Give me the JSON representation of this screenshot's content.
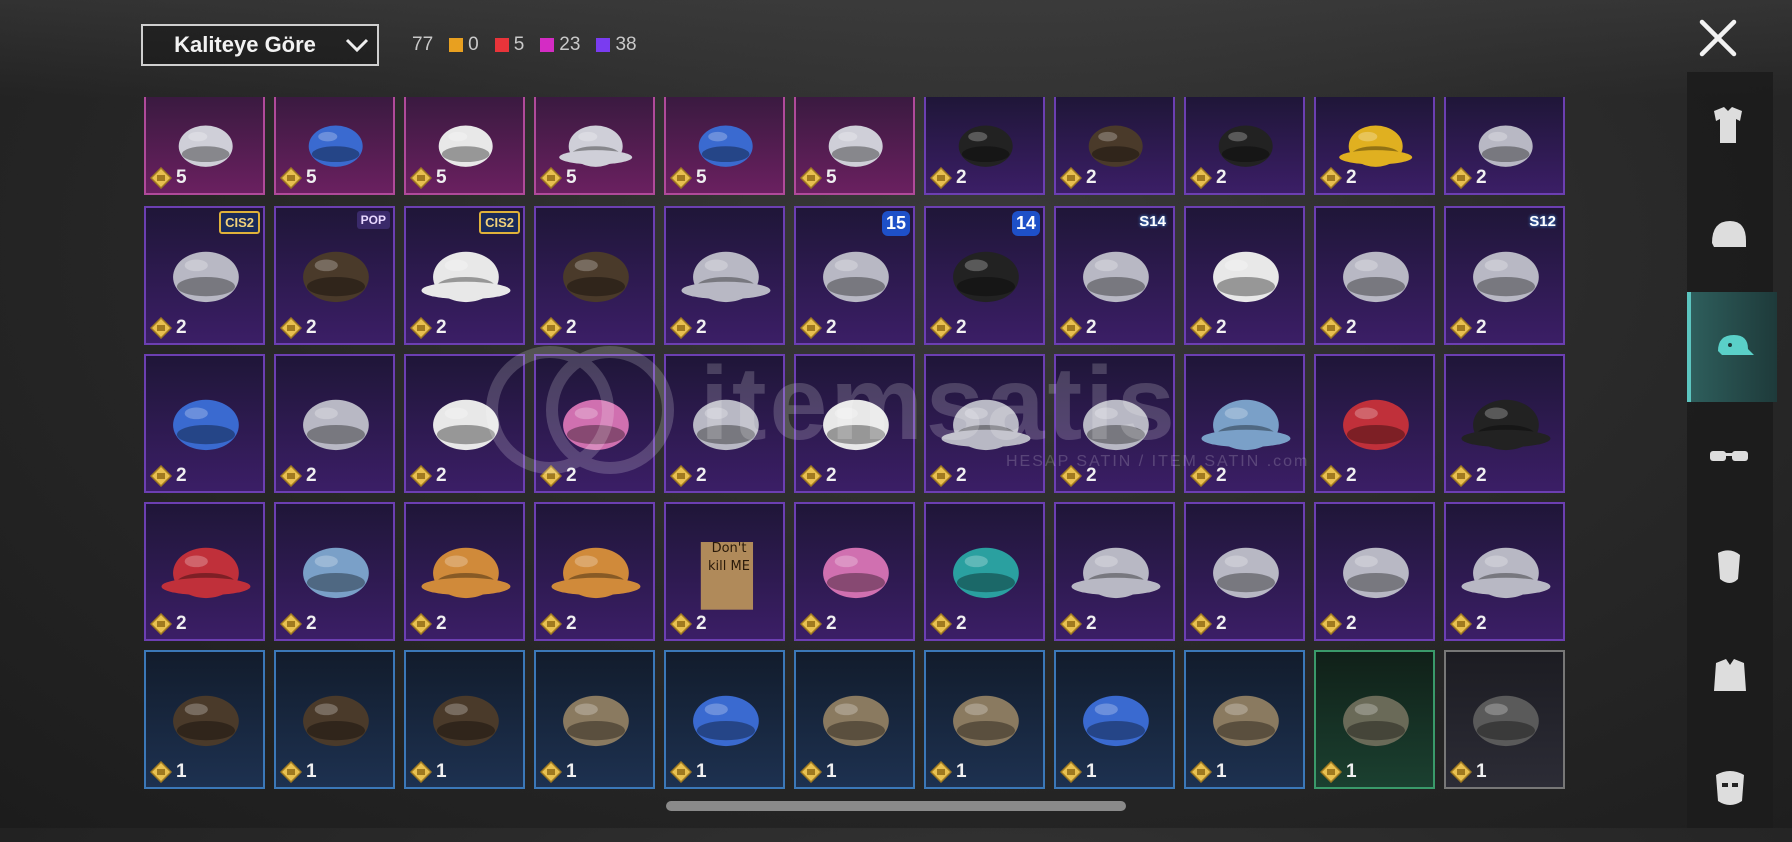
{
  "sort": {
    "label": "Kaliteye Göre"
  },
  "counts": {
    "total": "77",
    "groups": [
      {
        "color": "#e8a020",
        "value": "0"
      },
      {
        "color": "#e8343a",
        "value": "5"
      },
      {
        "color": "#d42cc4",
        "value": "23"
      },
      {
        "color": "#7a3cf0",
        "value": "38"
      }
    ]
  },
  "watermark": {
    "brand": "itemsatis",
    "tagline": "HESAP SATIN / ITEM SATIN .com"
  },
  "rows": [
    {
      "tiles": [
        {
          "tier": "pink",
          "qty": "5",
          "icon": "mask-helmet-icon"
        },
        {
          "tier": "pink",
          "qty": "5",
          "icon": "blue-helmet-icon"
        },
        {
          "tier": "pink",
          "qty": "5",
          "icon": "white-helmet-icon"
        },
        {
          "tier": "pink",
          "qty": "5",
          "icon": "witch-hat-icon"
        },
        {
          "tier": "pink",
          "qty": "5",
          "icon": "goggle-helmet-icon"
        },
        {
          "tier": "pink",
          "qty": "5",
          "icon": "horn-headband-icon"
        },
        {
          "tier": "purple",
          "qty": "2",
          "icon": "dark-hair-icon"
        },
        {
          "tier": "purple",
          "qty": "2",
          "icon": "gray-hair-icon"
        },
        {
          "tier": "purple",
          "qty": "2",
          "icon": "black-cap-icon"
        },
        {
          "tier": "purple",
          "qty": "2",
          "icon": "yellow-hat-icon"
        },
        {
          "tier": "purple",
          "qty": "2",
          "icon": "horned-helmet-icon"
        }
      ]
    },
    {
      "tiles": [
        {
          "tier": "purple",
          "qty": "2",
          "icon": "striped-beanie-icon",
          "badge": "CIS2",
          "badgeType": "cis"
        },
        {
          "tier": "purple",
          "qty": "2",
          "icon": "silver-hair-icon",
          "badge": "POP",
          "badgeType": "pop"
        },
        {
          "tier": "purple",
          "qty": "2",
          "icon": "chef-hat-icon",
          "badge": "CIS2",
          "badgeType": "cis"
        },
        {
          "tier": "purple",
          "qty": "2",
          "icon": "brown-hair-icon"
        },
        {
          "tier": "purple",
          "qty": "2",
          "icon": "fedora-icon"
        },
        {
          "tier": "purple",
          "qty": "2",
          "icon": "knight-helmet-icon",
          "badge": "15",
          "badgeType": "num"
        },
        {
          "tier": "purple",
          "qty": "2",
          "icon": "police-cap-icon",
          "badge": "14",
          "badgeType": "num"
        },
        {
          "tier": "purple",
          "qty": "2",
          "icon": "spartan-helmet-icon",
          "badge": "S14",
          "badgeType": "s"
        },
        {
          "tier": "purple",
          "qty": "2",
          "icon": "white-turban-icon"
        },
        {
          "tier": "purple",
          "qty": "2",
          "icon": "spiked-helmet-icon"
        },
        {
          "tier": "purple",
          "qty": "2",
          "icon": "space-helmet-icon",
          "badge": "S12",
          "badgeType": "s"
        }
      ]
    },
    {
      "tiles": [
        {
          "tier": "purple",
          "qty": "2",
          "icon": "bird-beanie-icon"
        },
        {
          "tier": "purple",
          "qty": "2",
          "icon": "knit-beanie-icon"
        },
        {
          "tier": "purple",
          "qty": "2",
          "icon": "turban-icon"
        },
        {
          "tier": "purple",
          "qty": "2",
          "icon": "cat-headphones-pink-icon"
        },
        {
          "tier": "purple",
          "qty": "2",
          "icon": "gray-helmet-icon"
        },
        {
          "tier": "purple",
          "qty": "2",
          "icon": "cat-headphones-white-icon"
        },
        {
          "tier": "purple",
          "qty": "2",
          "icon": "feather-hat-icon"
        },
        {
          "tier": "purple",
          "qty": "2",
          "icon": "gladiator-helmet-icon"
        },
        {
          "tier": "purple",
          "qty": "2",
          "icon": "shark-hat-icon"
        },
        {
          "tier": "purple",
          "qty": "2",
          "icon": "red-beret-icon"
        },
        {
          "tier": "purple",
          "qty": "2",
          "icon": "black-fedora-icon"
        }
      ]
    },
    {
      "tiles": [
        {
          "tier": "purple",
          "qty": "2",
          "icon": "red-fedora-icon"
        },
        {
          "tier": "purple",
          "qty": "2",
          "icon": "shark-mask-icon"
        },
        {
          "tier": "purple",
          "qty": "2",
          "icon": "cake-hat-icon"
        },
        {
          "tier": "purple",
          "qty": "2",
          "icon": "burger-hat-icon"
        },
        {
          "tier": "purple",
          "qty": "2",
          "icon": "paper-bag-icon",
          "bagText": "Don't kill ME"
        },
        {
          "tier": "purple",
          "qty": "2",
          "icon": "pink-cap-icon"
        },
        {
          "tier": "purple",
          "qty": "2",
          "icon": "teal-cap-icon"
        },
        {
          "tier": "purple",
          "qty": "2",
          "icon": "maroon-fedora-icon"
        },
        {
          "tier": "purple",
          "qty": "2",
          "icon": "net-helmet-icon"
        },
        {
          "tier": "purple",
          "qty": "2",
          "icon": "aviator-helmet-icon"
        },
        {
          "tier": "purple",
          "qty": "2",
          "icon": "camo-hat-icon"
        }
      ]
    },
    {
      "tiles": [
        {
          "tier": "blue",
          "qty": "1",
          "icon": "hair-clip-icon"
        },
        {
          "tier": "blue",
          "qty": "1",
          "icon": "hair-clip-icon"
        },
        {
          "tier": "blue",
          "qty": "1",
          "icon": "hair-clip-icon"
        },
        {
          "tier": "blue",
          "qty": "1",
          "icon": "bandana-icon"
        },
        {
          "tier": "blue",
          "qty": "1",
          "icon": "blue-beret-icon"
        },
        {
          "tier": "blue",
          "qty": "1",
          "icon": "gray-beret-icon"
        },
        {
          "tier": "blue",
          "qty": "1",
          "icon": "baseball-cap-icon"
        },
        {
          "tier": "blue",
          "qty": "1",
          "icon": "baseball-cap-blue-icon"
        },
        {
          "tier": "blue",
          "qty": "1",
          "icon": "headset-cap-icon"
        },
        {
          "tier": "green",
          "qty": "1",
          "icon": "military-cap-icon"
        },
        {
          "tier": "gray",
          "qty": "1",
          "icon": "gray-beanie-icon"
        }
      ]
    }
  ],
  "sidebar": [
    {
      "icon": "outfit-icon"
    },
    {
      "icon": "helmet-icon"
    },
    {
      "icon": "cap-icon",
      "active": true
    },
    {
      "icon": "glasses-icon"
    },
    {
      "icon": "face-icon"
    },
    {
      "icon": "jacket-icon"
    },
    {
      "icon": "mask-icon"
    }
  ]
}
